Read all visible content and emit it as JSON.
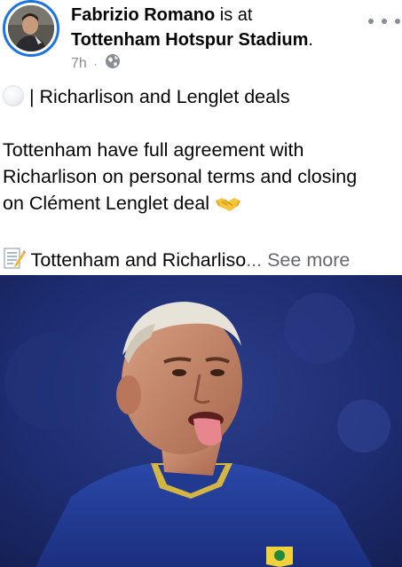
{
  "post": {
    "author": "Fabrizio Romano",
    "connector": " is at",
    "place": "Tottenham Hotspur Stadium",
    "place_suffix": ".",
    "time": "7h",
    "separator": "·",
    "audience_icon": "globe-icon",
    "more_icon": "more-options-icon",
    "text": {
      "headline": " | Richarlison and Lenglet deals",
      "body_line1": "Tottenham have full agreement with",
      "body_line2": "Richarlison on personal terms and closing",
      "body_line3": "on Clément Lenglet deal ",
      "teaser": " Tottenham and Richarliso",
      "ellipsis": "...",
      "see_more": "See more"
    },
    "emoji": {
      "headline": "white-circle-emoji",
      "body": "handshake-emoji",
      "teaser": "memo-emoji"
    }
  },
  "colors": {
    "ring": "#1b74e4",
    "meta": "#8a8d91",
    "text": "#050505",
    "see_more": "#65676b",
    "jersey": "#1f3a8f"
  }
}
